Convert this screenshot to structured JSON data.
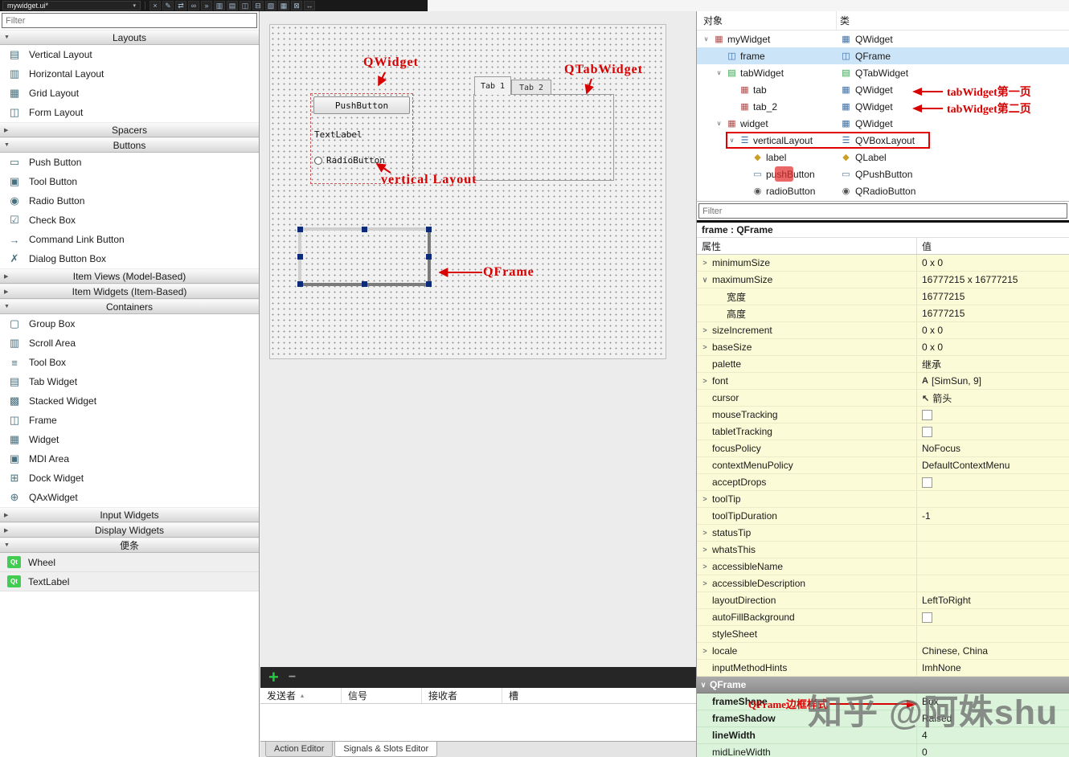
{
  "toolbar": {
    "file_combo": "mywidget.ui*",
    "icons": [
      {
        "name": "close-file-icon",
        "glyph": "×"
      },
      {
        "name": "edit-widgets-icon",
        "glyph": "✎"
      },
      {
        "name": "edit-signals-slots-icon",
        "glyph": "⇄"
      },
      {
        "name": "edit-buddies-icon",
        "glyph": "∞"
      },
      {
        "name": "edit-tab-order-icon",
        "glyph": "»"
      },
      {
        "name": "layout-horizontally-icon",
        "glyph": "▥"
      },
      {
        "name": "layout-vertically-icon",
        "glyph": "▤"
      },
      {
        "name": "layout-splitter-horizontal-icon",
        "glyph": "◫"
      },
      {
        "name": "layout-splitter-vertical-icon",
        "glyph": "⊟"
      },
      {
        "name": "layout-form-icon",
        "glyph": "▧"
      },
      {
        "name": "layout-grid-icon",
        "glyph": "▦"
      },
      {
        "name": "break-layout-icon",
        "glyph": "⊠"
      },
      {
        "name": "adjust-size-icon",
        "glyph": "↔"
      }
    ]
  },
  "glyphs": {
    "combo_caret": "▾",
    "section_expanded": "▼",
    "section_collapsed": "▶",
    "chevron_down": "∨",
    "chevron_right": ">",
    "sort_asc": "▴"
  },
  "widget_box": {
    "filter_placeholder": "Filter",
    "sections": [
      {
        "id": "layouts",
        "label": "Layouts",
        "expanded": true,
        "items": [
          {
            "label": "Vertical Layout",
            "icon": "vertical-layout-icon",
            "glyph": "▤"
          },
          {
            "label": "Horizontal Layout",
            "icon": "horizontal-layout-icon",
            "glyph": "▥"
          },
          {
            "label": "Grid Layout",
            "icon": "grid-layout-icon",
            "glyph": "▦"
          },
          {
            "label": "Form Layout",
            "icon": "form-layout-icon",
            "glyph": "◫"
          }
        ]
      },
      {
        "id": "spacers",
        "label": "Spacers",
        "expanded": false,
        "items": []
      },
      {
        "id": "buttons",
        "label": "Buttons",
        "expanded": true,
        "items": [
          {
            "label": "Push Button",
            "icon": "push-button-icon",
            "glyph": "▭"
          },
          {
            "label": "Tool Button",
            "icon": "tool-button-icon",
            "glyph": "▣"
          },
          {
            "label": "Radio Button",
            "icon": "radio-button-icon",
            "glyph": "◉"
          },
          {
            "label": "Check Box",
            "icon": "check-box-icon",
            "glyph": "☑"
          },
          {
            "label": "Command Link Button",
            "icon": "command-link-button-icon",
            "glyph": "→"
          },
          {
            "label": "Dialog Button Box",
            "icon": "dialog-button-box-icon",
            "glyph": "✗"
          }
        ]
      },
      {
        "id": "item-views",
        "label": "Item Views (Model-Based)",
        "expanded": false,
        "items": []
      },
      {
        "id": "item-widgets",
        "label": "Item Widgets (Item-Based)",
        "expanded": false,
        "items": []
      },
      {
        "id": "containers",
        "label": "Containers",
        "expanded": true,
        "items": [
          {
            "label": "Group Box",
            "icon": "group-box-icon",
            "glyph": "▢"
          },
          {
            "label": "Scroll Area",
            "icon": "scroll-area-icon",
            "glyph": "▥"
          },
          {
            "label": "Tool Box",
            "icon": "tool-box-icon",
            "glyph": "≡"
          },
          {
            "label": "Tab Widget",
            "icon": "tab-widget-icon",
            "glyph": "▤"
          },
          {
            "label": "Stacked Widget",
            "icon": "stacked-widget-icon",
            "glyph": "▩"
          },
          {
            "label": "Frame",
            "icon": "frame-icon",
            "glyph": "◫"
          },
          {
            "label": "Widget",
            "icon": "widget-icon",
            "glyph": "▦"
          },
          {
            "label": "MDI Area",
            "icon": "mdi-area-icon",
            "glyph": "▣"
          },
          {
            "label": "Dock Widget",
            "icon": "dock-widget-icon",
            "glyph": "⊞"
          },
          {
            "label": "QAxWidget",
            "icon": "qaxwidget-icon",
            "glyph": "⊕"
          }
        ]
      },
      {
        "id": "input-widgets",
        "label": "Input Widgets",
        "expanded": false,
        "items": []
      },
      {
        "id": "display-widgets",
        "label": "Display Widgets",
        "expanded": false,
        "items": []
      },
      {
        "id": "scratchpad",
        "label": "便条",
        "expanded": true,
        "items": [
          {
            "label": "Wheel",
            "icon": "qt-widget-icon",
            "glyph": "Qt",
            "qt": true
          },
          {
            "label": "TextLabel",
            "icon": "qt-widget-icon",
            "glyph": "Qt",
            "qt": true
          }
        ]
      }
    ]
  },
  "canvas": {
    "form": {
      "push_button_label": "PushButton",
      "text_label": "TextLabel",
      "radio_label": "RadioButton",
      "tab1_label": "Tab 1",
      "tab2_label": "Tab 2"
    },
    "annotations": {
      "qwidget": "QWidget",
      "qtabwidget": "QTabWidget",
      "vertical_layout": "vertical Layout",
      "qframe": "QFrame"
    }
  },
  "object_inspector": {
    "col_object": "对象",
    "col_class": "类",
    "rows": [
      {
        "name": "myWidget",
        "klass": "QWidget",
        "ind": 0,
        "exp": true,
        "nicon": "qwidget-icon",
        "nglyph": "▦",
        "ncolor": "#b04a4a",
        "kicon": "qwidget-class-icon",
        "kglyph": "▦",
        "kcolor": "#3b6ea5"
      },
      {
        "name": "frame",
        "klass": "QFrame",
        "ind": 1,
        "nicon": "qframe-icon",
        "nglyph": "◫",
        "ncolor": "#3b6ea5",
        "kicon": "qframe-class-icon",
        "kglyph": "◫",
        "kcolor": "#3b6ea5",
        "selected": true
      },
      {
        "name": "tabWidget",
        "klass": "QTabWidget",
        "ind": 1,
        "exp": true,
        "nicon": "qtabwidget-icon",
        "nglyph": "▤",
        "ncolor": "#2e9e44",
        "kicon": "qtabwidget-class-icon",
        "kglyph": "▤",
        "kcolor": "#2e9e44"
      },
      {
        "name": "tab",
        "klass": "QWidget",
        "ind": 2,
        "nicon": "qwidget-icon",
        "nglyph": "▦",
        "ncolor": "#b04a4a",
        "kicon": "qwidget-class-icon",
        "kglyph": "▦",
        "kcolor": "#3b6ea5",
        "annotation": "tabWidget第一页"
      },
      {
        "name": "tab_2",
        "klass": "QWidget",
        "ind": 2,
        "nicon": "qwidget-icon",
        "nglyph": "▦",
        "ncolor": "#b04a4a",
        "kicon": "qwidget-class-icon",
        "kglyph": "▦",
        "kcolor": "#3b6ea5",
        "annotation": "tabWidget第二页"
      },
      {
        "name": "widget",
        "klass": "QWidget",
        "ind": 1,
        "exp": true,
        "nicon": "qwidget-icon",
        "nglyph": "▦",
        "ncolor": "#b04a4a",
        "kicon": "qwidget-class-icon",
        "kglyph": "▦",
        "kcolor": "#3b6ea5"
      },
      {
        "name": "verticalLayout",
        "klass": "QVBoxLayout",
        "ind": 2,
        "exp": true,
        "nicon": "vbox-layout-icon",
        "nglyph": "☰",
        "ncolor": "#3b6ea5",
        "kicon": "vbox-layout-class-icon",
        "kglyph": "☰",
        "kcolor": "#3b6ea5",
        "redbox": true
      },
      {
        "name": "label",
        "klass": "QLabel",
        "ind": 3,
        "nicon": "qlabel-icon",
        "nglyph": "◆",
        "ncolor": "#c8a028",
        "kicon": "qlabel-class-icon",
        "kglyph": "◆",
        "kcolor": "#c8a028"
      },
      {
        "name": "pushButton",
        "klass": "QPushButton",
        "ind": 3,
        "nicon": "qpushbutton-icon",
        "nglyph": "▭",
        "ncolor": "#5a7a9a",
        "kicon": "qpushbutton-class-icon",
        "kglyph": "▭",
        "kcolor": "#5a7a9a",
        "redmark": true
      },
      {
        "name": "radioButton",
        "klass": "QRadioButton",
        "ind": 3,
        "nicon": "qradiobutton-icon",
        "nglyph": "◉",
        "ncolor": "#555555",
        "kicon": "qradiobutton-class-icon",
        "kglyph": "◉",
        "kcolor": "#555555"
      }
    ]
  },
  "property_editor": {
    "filter_placeholder": "Filter",
    "object_label": "frame : QFrame",
    "col_property": "属性",
    "col_value": "值",
    "rows": [
      {
        "key": "minimumSize",
        "name": "minimumSize",
        "value": "0 x 0",
        "exp": "right"
      },
      {
        "key": "maximumSize",
        "name": "maximumSize",
        "value": "16777215 x 16777215",
        "exp": "down"
      },
      {
        "key": "width",
        "name": "宽度",
        "value": "16777215",
        "indent": 1
      },
      {
        "key": "height",
        "name": "高度",
        "value": "16777215",
        "indent": 1
      },
      {
        "key": "sizeIncrement",
        "name": "sizeIncrement",
        "value": "0 x 0",
        "exp": "right"
      },
      {
        "key": "baseSize",
        "name": "baseSize",
        "value": "0 x 0",
        "exp": "right"
      },
      {
        "key": "palette",
        "name": "palette",
        "value": "继承"
      },
      {
        "key": "font",
        "name": "font",
        "value": "[SimSun, 9]",
        "exp": "right",
        "vicon": "font-icon",
        "vglyph": "A"
      },
      {
        "key": "cursor",
        "name": "cursor",
        "value": "箭头",
        "vicon": "cursor-icon",
        "vglyph": "↖"
      },
      {
        "key": "mouseTracking",
        "name": "mouseTracking",
        "kind": "check"
      },
      {
        "key": "tabletTracking",
        "name": "tabletTracking",
        "kind": "check"
      },
      {
        "key": "focusPolicy",
        "name": "focusPolicy",
        "value": "NoFocus"
      },
      {
        "key": "contextMenuPolicy",
        "name": "contextMenuPolicy",
        "value": "DefaultContextMenu"
      },
      {
        "key": "acceptDrops",
        "name": "acceptDrops",
        "kind": "check"
      },
      {
        "key": "toolTip",
        "name": "toolTip",
        "value": "",
        "exp": "right"
      },
      {
        "key": "toolTipDuration",
        "name": "toolTipDuration",
        "value": "-1"
      },
      {
        "key": "statusTip",
        "name": "statusTip",
        "value": "",
        "exp": "right"
      },
      {
        "key": "whatsThis",
        "name": "whatsThis",
        "value": "",
        "exp": "right"
      },
      {
        "key": "accessibleName",
        "name": "accessibleName",
        "value": "",
        "exp": "right"
      },
      {
        "key": "accessibleDescription",
        "name": "accessibleDescription",
        "value": "",
        "exp": "right"
      },
      {
        "key": "layoutDirection",
        "name": "layoutDirection",
        "value": "LeftToRight"
      },
      {
        "key": "autoFillBackground",
        "name": "autoFillBackground",
        "kind": "check"
      },
      {
        "key": "styleSheet",
        "name": "styleSheet",
        "value": ""
      },
      {
        "key": "locale",
        "name": "locale",
        "value": "Chinese, China",
        "exp": "right"
      },
      {
        "key": "inputMethodHints",
        "name": "inputMethodHints",
        "value": "ImhNone"
      },
      {
        "key": "QFrame",
        "name": "QFrame",
        "kind": "group"
      },
      {
        "key": "frameShape",
        "name": "frameShape",
        "value": "Box",
        "green": true,
        "bold": true,
        "annotation": "QFrame边框样式"
      },
      {
        "key": "frameShadow",
        "name": "frameShadow",
        "value": "Raised",
        "green": true,
        "bold": true
      },
      {
        "key": "lineWidth",
        "name": "lineWidth",
        "value": "4",
        "green": true,
        "bold": true
      },
      {
        "key": "midLineWidth",
        "name": "midLineWidth",
        "value": "0",
        "green": true
      }
    ]
  },
  "signal_editor": {
    "add_glyph": "+",
    "remove_glyph": "−",
    "columns": [
      "发送者",
      "信号",
      "接收者",
      "槽"
    ],
    "tabs": [
      {
        "label": "Action Editor",
        "active": false
      },
      {
        "label": "Signals & Slots Editor",
        "active": true
      }
    ]
  },
  "watermark": {
    "text": "知乎 @阿姝shu"
  },
  "colors": {
    "annotation_red": "#d80000",
    "selection_blue": "#cbe4f7",
    "row_yellow": "#fbfbd7",
    "row_green": "#daf3da",
    "qt_green": "#41cd52"
  }
}
